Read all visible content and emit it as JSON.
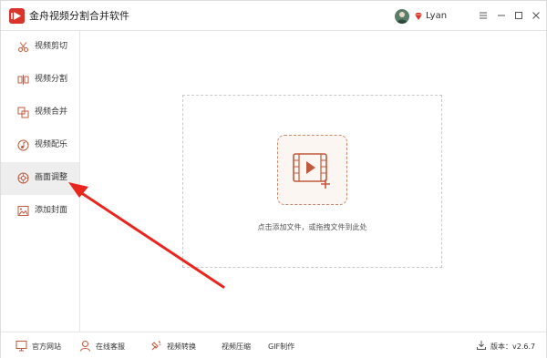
{
  "app": {
    "title": "金舟视频分割合并软件",
    "username": "Lyan",
    "accent_color": "#d8342c"
  },
  "sidebar": {
    "items": [
      {
        "label": "视频剪切",
        "icon": "scissors-icon",
        "active": false
      },
      {
        "label": "视频分割",
        "icon": "split-icon",
        "active": false
      },
      {
        "label": "视频合并",
        "icon": "merge-icon",
        "active": false
      },
      {
        "label": "视频配乐",
        "icon": "music-icon",
        "active": false
      },
      {
        "label": "画面调整",
        "icon": "adjust-icon",
        "active": true
      },
      {
        "label": "添加封面",
        "icon": "image-icon",
        "active": false
      }
    ]
  },
  "main": {
    "drop_hint": "点击添加文件，或拖拽文件到此处"
  },
  "bottombar": {
    "links": [
      {
        "label": "官方网站",
        "icon": "monitor-icon"
      },
      {
        "label": "在线客服",
        "icon": "headset-icon"
      },
      {
        "label": "视频转换",
        "icon": "convert-icon"
      },
      {
        "label": "视频压缩",
        "icon": ""
      },
      {
        "label": "GIF制作",
        "icon": ""
      }
    ],
    "version": "版本：v2.6.7"
  }
}
